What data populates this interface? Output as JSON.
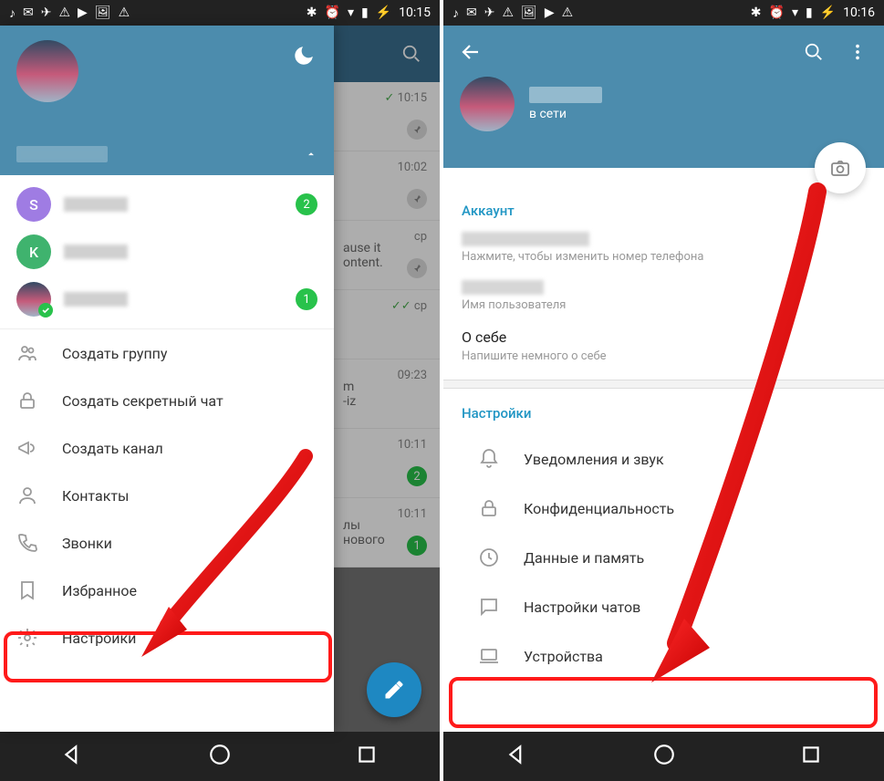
{
  "left": {
    "statusbar_time": "10:15",
    "drawer": {
      "accounts": [
        {
          "initial": "S",
          "color": "#9f7ce3",
          "badge": "2"
        },
        {
          "initial": "K",
          "color": "#3fb36e",
          "badge": ""
        },
        {
          "initial": "",
          "color": "",
          "badge": "1",
          "avatar": true,
          "check": true
        }
      ],
      "menu": [
        {
          "label": "Создать группу"
        },
        {
          "label": "Создать секретный чат"
        },
        {
          "label": "Создать канал"
        },
        {
          "label": "Контакты"
        },
        {
          "label": "Звонки"
        },
        {
          "label": "Избранное"
        },
        {
          "label": "Настройки"
        }
      ]
    },
    "chatlist": [
      {
        "time": "10:15",
        "check": true
      },
      {
        "time": "10:02"
      },
      {
        "time": "ср",
        "text1": "ause it",
        "text2": "ontent."
      },
      {
        "time": "ср",
        "dblcheck": true
      },
      {
        "time": "09:23",
        "text1": "m",
        "text2": "-iz"
      },
      {
        "time": "10:11",
        "badge": "2"
      },
      {
        "time": "10:11",
        "badge": "1",
        "text1": "лы",
        "text2": "нового"
      }
    ]
  },
  "right": {
    "statusbar_time": "10:16",
    "status_text": "в сети",
    "account_section_title": "Аккаунт",
    "phone_hint": "Нажмите, чтобы изменить номер телефона",
    "username_hint": "Имя пользователя",
    "bio_label": "О себе",
    "bio_hint": "Напишите немного о себе",
    "settings_section_title": "Настройки",
    "settings": [
      {
        "label": "Уведомления и звук"
      },
      {
        "label": "Конфиденциальность"
      },
      {
        "label": "Данные и память"
      },
      {
        "label": "Настройки чатов"
      },
      {
        "label": "Устройства"
      }
    ]
  }
}
